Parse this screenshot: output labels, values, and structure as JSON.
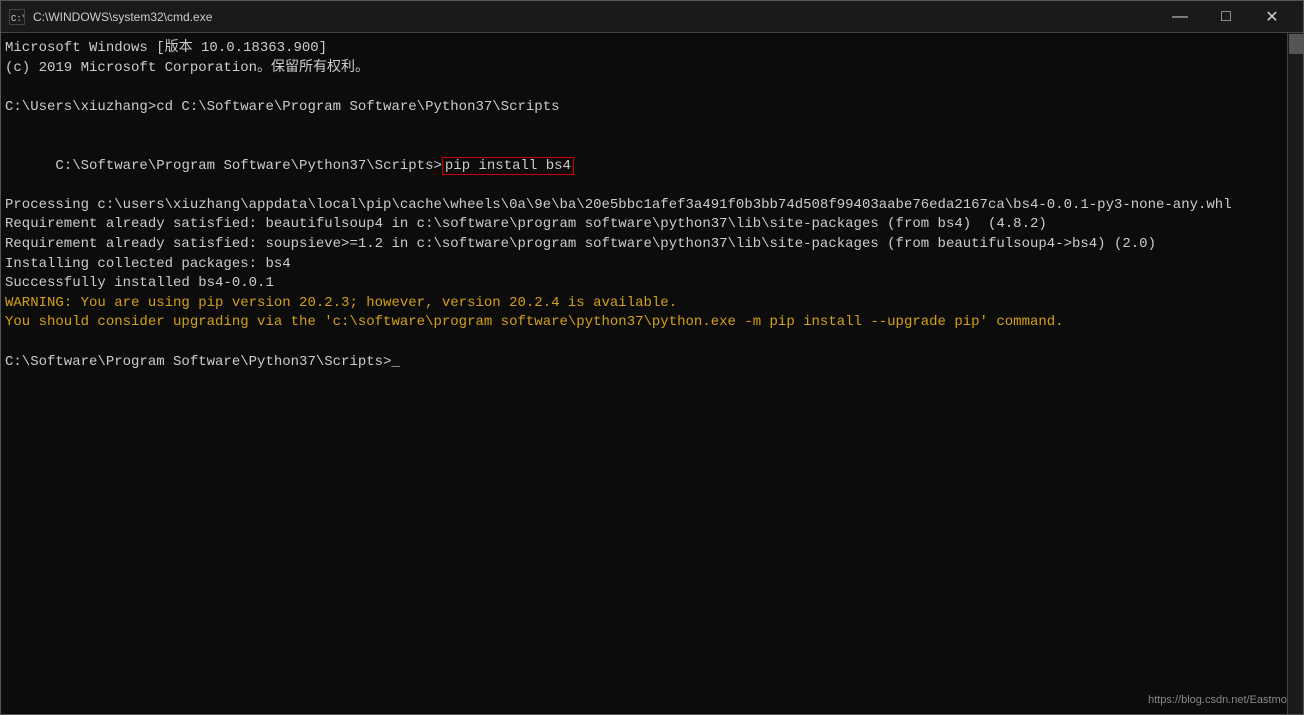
{
  "titleBar": {
    "icon": "C:\\",
    "title": "C:\\WINDOWS\\system32\\cmd.exe",
    "minimizeLabel": "—",
    "maximizeLabel": "□",
    "closeLabel": "✕"
  },
  "terminal": {
    "lines": [
      {
        "id": "line1",
        "text": "Microsoft Windows [版本 10.0.18363.900]",
        "color": "white"
      },
      {
        "id": "line2",
        "text": "(c) 2019 Microsoft Corporation。保留所有权利。",
        "color": "white"
      },
      {
        "id": "line3",
        "text": "",
        "color": "white"
      },
      {
        "id": "line4",
        "text": "C:\\Users\\xiuzhang>cd C:\\Software\\Program Software\\Python37\\Scripts",
        "color": "white"
      },
      {
        "id": "line5",
        "text": "",
        "color": "white"
      },
      {
        "id": "line6a",
        "text": "C:\\Software\\Program Software\\Python37\\Scripts>",
        "color": "white"
      },
      {
        "id": "line6b",
        "text": "pip install bs4",
        "color": "white",
        "highlight": true
      },
      {
        "id": "line7",
        "text": "Processing c:\\users\\xiuzhang\\appdata\\local\\pip\\cache\\wheels\\0a\\9e\\ba\\20e5bbc1afef3a491f0b3bb74d508f99403aabe76eda2167ca\\bs4-0.0.1-py3-none-any.whl",
        "color": "white"
      },
      {
        "id": "line8",
        "text": "Requirement already satisfied: beautifulsoup4 in c:\\software\\program software\\python37\\lib\\site-packages (from bs4)  (4.8.2)",
        "color": "white"
      },
      {
        "id": "line9",
        "text": "Requirement already satisfied: soupsieve>=1.2 in c:\\software\\program software\\python37\\lib\\site-packages (from beautifulsoup4->bs4) (2.0)",
        "color": "white"
      },
      {
        "id": "line10",
        "text": "Installing collected packages: bs4",
        "color": "white"
      },
      {
        "id": "line11",
        "text": "Successfully installed bs4-0.0.1",
        "color": "white"
      },
      {
        "id": "line12",
        "text": "WARNING: You are using pip version 20.2.3; however, version 20.2.4 is available.",
        "color": "yellow"
      },
      {
        "id": "line13",
        "text": "You should consider upgrading via the 'c:\\software\\program software\\python37\\python.exe -m pip install --upgrade pip' command.",
        "color": "yellow"
      },
      {
        "id": "line14",
        "text": "",
        "color": "white"
      },
      {
        "id": "line15",
        "text": "C:\\Software\\Program Software\\Python37\\Scripts>_",
        "color": "white"
      }
    ],
    "watermark": "https://blog.csdn.net/Eastmou"
  }
}
